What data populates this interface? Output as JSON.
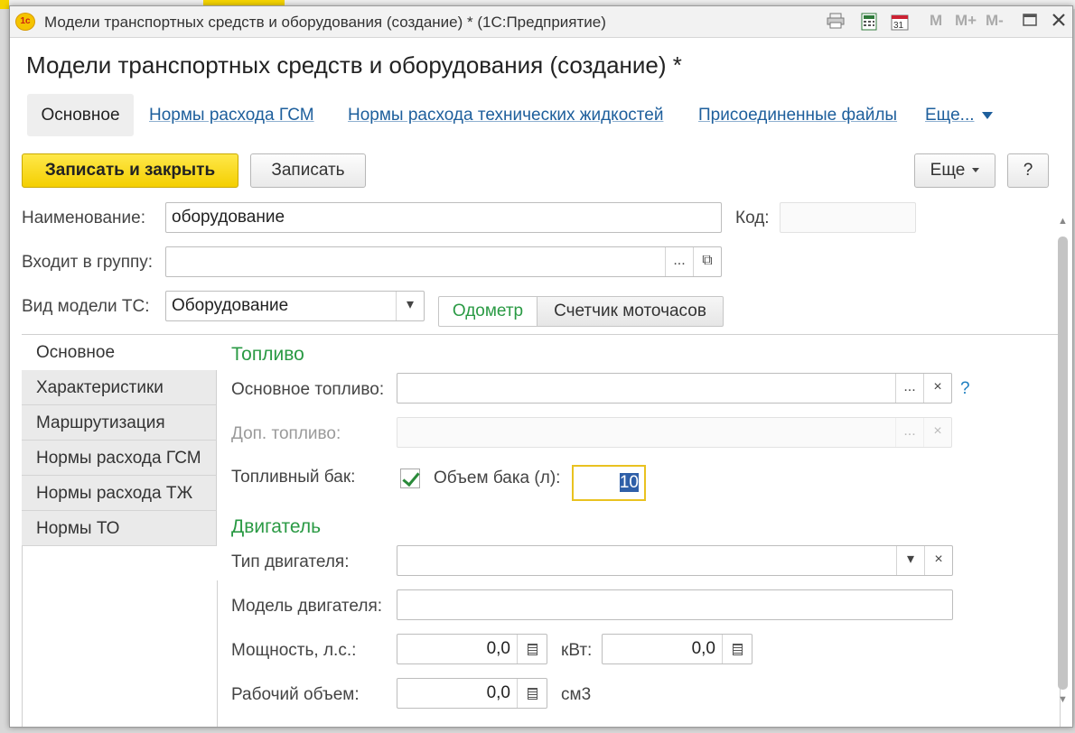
{
  "window": {
    "title": "Модели транспортных средств и оборудования  (создание) *  (1С:Предприятие)",
    "logo_text": "1c",
    "toolbar_icons": [
      "print-icon",
      "calculator-icon",
      "calendar-icon"
    ],
    "calendar_day": "31",
    "m_buttons": [
      "M",
      "M+",
      "M-"
    ]
  },
  "form": {
    "title": "Модели транспортных средств и оборудования  (создание) *",
    "nav_tabs": [
      {
        "label": "Основное",
        "active": true
      },
      {
        "label": "Нормы расхода ГСМ"
      },
      {
        "label": "Нормы расхода технических жидкостей"
      },
      {
        "label": "Присоединенные файлы"
      },
      {
        "label": "Еще..."
      }
    ]
  },
  "toolbar": {
    "save_close_label": "Записать и закрыть",
    "save_label": "Записать",
    "more_label": "Еще",
    "help_label": "?"
  },
  "fields": {
    "name_label": "Наименование:",
    "name_value": "оборудование",
    "code_label": "Код:",
    "code_value": "",
    "group_label": "Входит в группу:",
    "group_value": "",
    "model_kind_label": "Вид модели ТС:",
    "model_kind_value": "Оборудование",
    "odometer_label": "Одометр",
    "motohours_label": "Счетчик моточасов"
  },
  "side_tabs": [
    {
      "label": "Основное",
      "active": true
    },
    {
      "label": "Характеристики"
    },
    {
      "label": "Маршрутизация"
    },
    {
      "label": "Нормы расхода ГСМ"
    },
    {
      "label": "Нормы расхода ТЖ"
    },
    {
      "label": "Нормы ТО"
    }
  ],
  "fuel": {
    "section_title": "Топливо",
    "main_fuel_label": "Основное топливо:",
    "main_fuel_value": "",
    "extra_fuel_label": "Доп. топливо:",
    "extra_fuel_value": "",
    "tank_label": "Топливный бак:",
    "tank_checked": true,
    "tank_volume_label": "Объем бака (л):",
    "tank_volume_value": "10",
    "help_mark": "?"
  },
  "engine": {
    "section_title": "Двигатель",
    "type_label": "Тип двигателя:",
    "type_value": "",
    "model_label": "Модель двигателя:",
    "model_value": "",
    "power_label": "Мощность, л.с.:",
    "power_hp_value": "0,0",
    "kw_label": "кВт:",
    "power_kw_value": "0,0",
    "volume_label": "Рабочий объем:",
    "volume_value": "0,0",
    "volume_unit": "см3"
  },
  "glyphs": {
    "ellipsis": "...",
    "clear": "×",
    "dropdown": "▾",
    "open": "⧉"
  }
}
